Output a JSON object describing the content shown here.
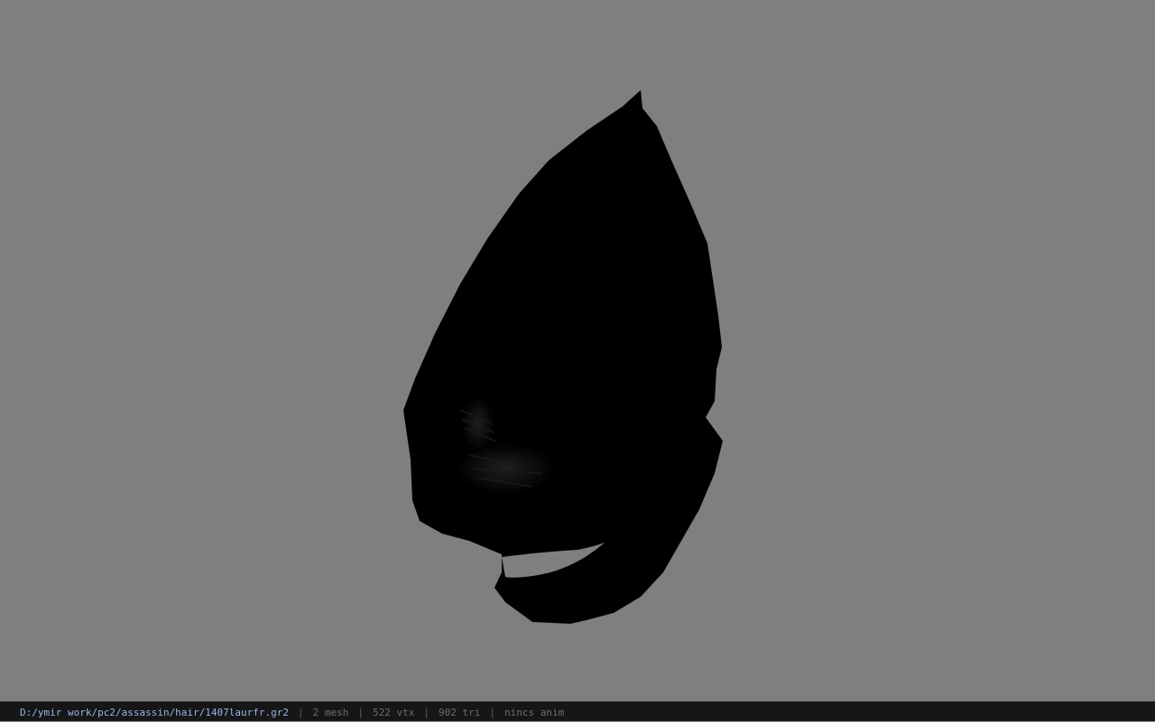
{
  "viewport": {
    "background": "#7f7f7f",
    "model_icon": "hair-mesh-model"
  },
  "statusbar": {
    "file_path": "D:/ymir work/pc2/assassin/hair/1407laurfr.gr2",
    "separator": "|",
    "mesh_count": "2 mesh",
    "vertex_count": "522 vtx",
    "triangle_count": "902 tri",
    "anim_status": "nincs anim",
    "path_color": "#9ab4e8",
    "text_color": "#6f6f6f"
  }
}
